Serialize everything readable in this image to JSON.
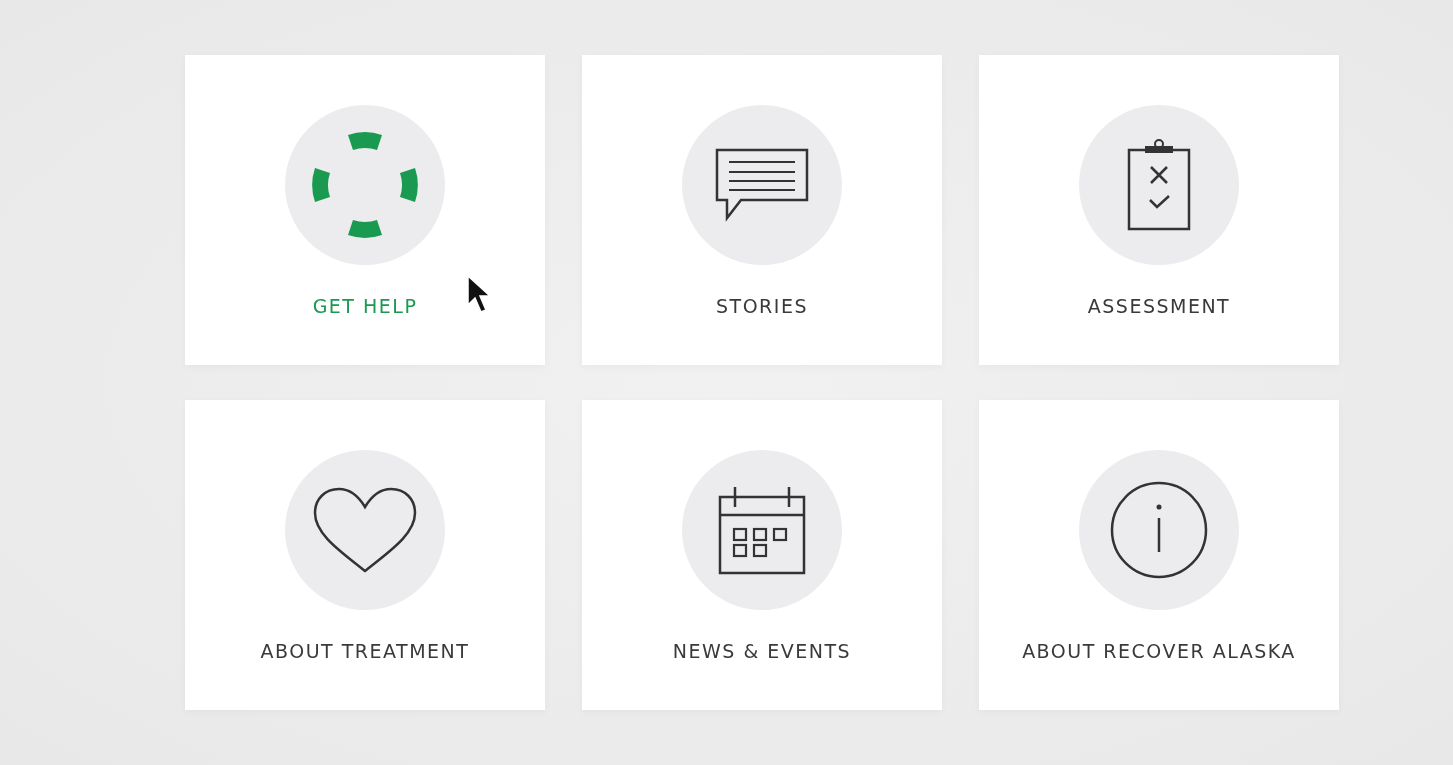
{
  "tiles": [
    {
      "label": "GET HELP",
      "kind": "lifebuoy",
      "selected": true
    },
    {
      "label": "STORIES",
      "kind": "chat",
      "selected": false
    },
    {
      "label": "ASSESSMENT",
      "kind": "clipboard",
      "selected": false
    },
    {
      "label": "ABOUT TREATMENT",
      "kind": "heart",
      "selected": false
    },
    {
      "label": "NEWS & EVENTS",
      "kind": "calendar",
      "selected": false
    },
    {
      "label": "ABOUT RECOVER ALASKA",
      "kind": "info",
      "selected": false
    }
  ]
}
